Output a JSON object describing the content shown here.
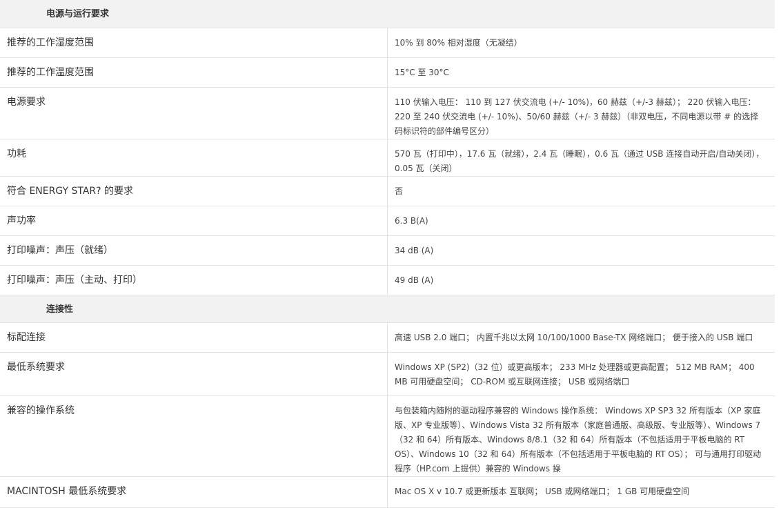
{
  "sections": [
    {
      "title": "电源与运行要求",
      "rows": [
        {
          "label": "推荐的工作湿度范围",
          "value": "10% 到 80% 相对湿度（无凝结）"
        },
        {
          "label": "推荐的工作温度范围",
          "value": "15°C 至 30°C"
        },
        {
          "label": "电源要求",
          "value": "110 伏输入电压： 110 到 127 伏交流电 (+/- 10%)，60 赫兹（+/-3 赫兹）； 220 伏输入电压： 220 至 240 伏交流电 (+/- 10%)、50/60 赫兹（+/- 3 赫兹）（非双电压，不同电源以带 # 的选择码标识符的部件编号区分）"
        },
        {
          "label": "功耗",
          "value": "570 瓦（打印中），17.6 瓦（就绪），2.4 瓦（睡眠），0.6 瓦（通过 USB 连接自动开启/自动关闭），0.05 瓦（关闭）"
        },
        {
          "label": "符合 ENERGY STAR? 的要求",
          "value": "否"
        },
        {
          "label": "声功率",
          "value": "6.3 B(A)"
        },
        {
          "label": "打印噪声：声压（就绪）",
          "value": "34 dB (A)"
        },
        {
          "label": "打印噪声：声压（主动、打印）",
          "value": "49 dB (A)"
        }
      ]
    },
    {
      "title": "连接性",
      "rows": [
        {
          "label": "标配连接",
          "value": "高速 USB 2.0 端口； 内置千兆以太网 10/100/1000 Base-TX 网络端口； 便于接入的 USB 端口"
        },
        {
          "label": "最低系统要求",
          "value": "Windows XP (SP2)（32 位）或更高版本； 233 MHz 处理器或更高配置； 512 MB RAM； 400 MB 可用硬盘空间； CD-ROM 或互联网连接； USB 或网络端口"
        },
        {
          "label": "兼容的操作系统",
          "value": "与包装箱内随附的驱动程序兼容的 Windows 操作系统： Windows XP SP3 32 所有版本（XP 家庭版、XP 专业版等）、Windows Vista 32 所有版本（家庭普通版、高级版、专业版等）、Windows 7（32 和 64）所有版本、Windows 8/8.1（32 和 64）所有版本（不包括适用于平板电脑的 RT OS）、Windows 10（32 和 64）所有版本（不包括适用于平板电脑的 RT OS）； 可与通用打印驱动程序（HP.com 上提供）兼容的 Windows 操"
        },
        {
          "label": "MACINTOSH 最低系统要求",
          "value": "Mac OS X v 10.7 或更新版本 互联网； USB 或网络端口； 1 GB 可用硬盘空间"
        }
      ]
    }
  ]
}
